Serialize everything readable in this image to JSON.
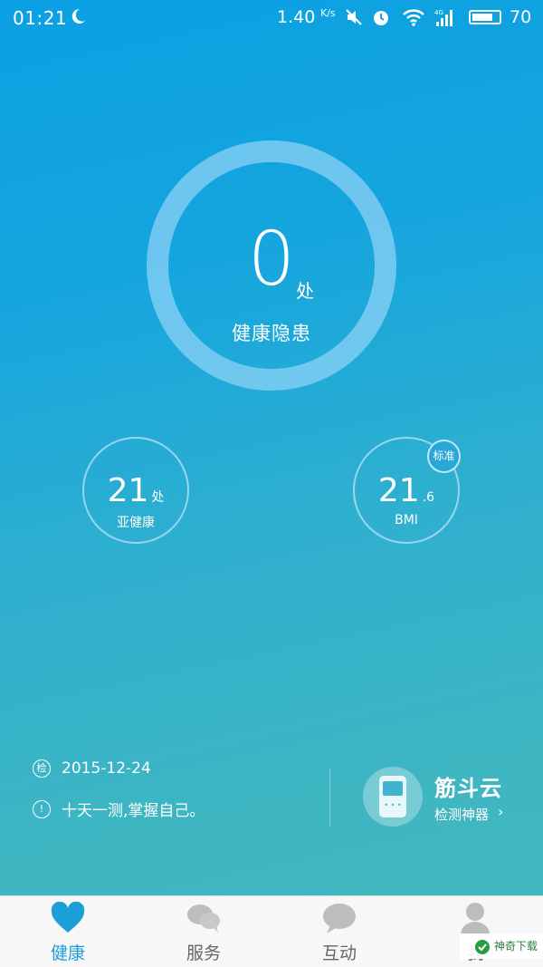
{
  "status_bar": {
    "time": "01:21",
    "net_speed": "1.40",
    "net_speed_unit": "K/s",
    "battery": "70",
    "icons": [
      "moon-icon",
      "mute-icon",
      "alarm-icon",
      "wifi-icon",
      "signal-4g-icon",
      "battery-icon"
    ]
  },
  "summary": {
    "hazard_count": "0",
    "hazard_unit": "处",
    "hazard_label": "健康隐患"
  },
  "metrics": {
    "subhealth": {
      "value": "21",
      "unit": "处",
      "label": "亚健康"
    },
    "bmi": {
      "value": "21",
      "decimal": ".6",
      "label": "BMI",
      "badge": "标准"
    }
  },
  "info": {
    "date": "2015-12-24",
    "date_icon_text": "检",
    "tip": "十天一测,掌握自己。"
  },
  "device": {
    "title": "筋斗云",
    "subtitle": "检测神器",
    "chevron": "›"
  },
  "tabs": [
    {
      "label": "健康",
      "icon": "heart-icon",
      "active": true
    },
    {
      "label": "服务",
      "icon": "chat-bubbles-icon",
      "active": false
    },
    {
      "label": "互动",
      "icon": "chat-bubble-icon",
      "active": false
    },
    {
      "label": "我",
      "icon": "person-icon",
      "active": false
    }
  ],
  "watermark": {
    "text": "神奇下载"
  },
  "colors": {
    "accent": "#1c9fd8",
    "tab_inactive": "#bdbdbd",
    "background_top": "#0aa0e3",
    "background_bottom": "#44b8bf"
  }
}
